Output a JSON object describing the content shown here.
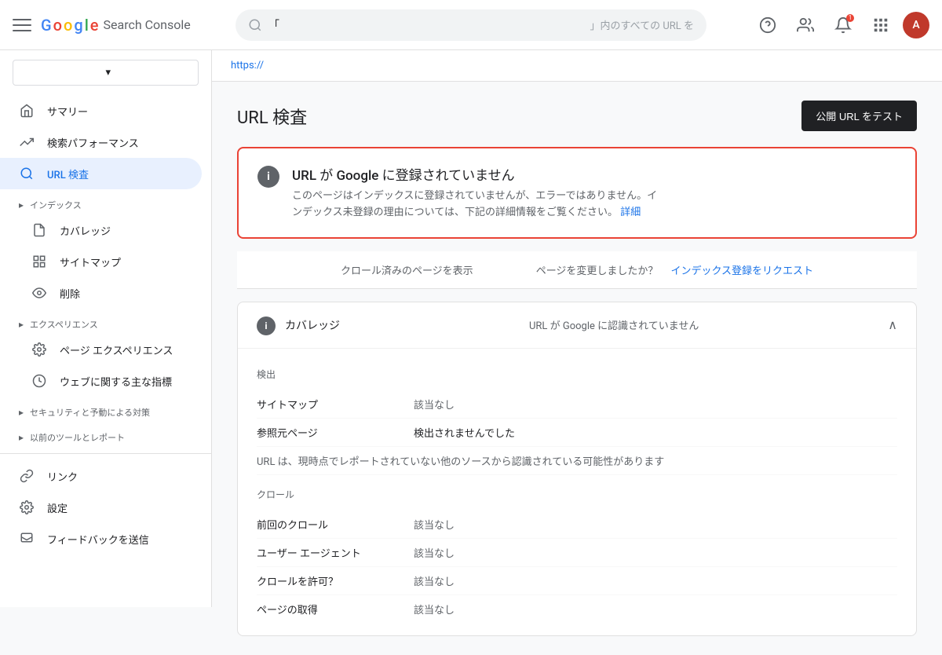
{
  "header": {
    "menu_icon": "≡",
    "logo": {
      "g": "G",
      "o1": "o",
      "o2": "o",
      "g2": "g",
      "l": "l",
      "e": "e"
    },
    "product_name": "Search Console",
    "search_placeholder": "」内のすべての URL を",
    "search_value": "「",
    "help_icon": "?",
    "accounts_icon": "👤",
    "notification_icon": "🔔",
    "notification_count": "1",
    "grid_icon": "⊞",
    "avatar_letter": "A"
  },
  "sidebar": {
    "property_placeholder": "",
    "nav_items": [
      {
        "id": "summary",
        "label": "サマリー",
        "icon": "🏠"
      },
      {
        "id": "search-performance",
        "label": "検索パフォーマンス",
        "icon": "↗"
      },
      {
        "id": "url-inspection",
        "label": "URL 検査",
        "icon": "🔍",
        "active": true
      }
    ],
    "section_index": {
      "label": "インデックス",
      "items": [
        {
          "id": "coverage",
          "label": "カバレッジ",
          "icon": "📄"
        },
        {
          "id": "sitemap",
          "label": "サイトマップ",
          "icon": "🗺"
        },
        {
          "id": "removal",
          "label": "削除",
          "icon": "👁"
        }
      ]
    },
    "section_experience": {
      "label": "エクスペリエンス",
      "items": [
        {
          "id": "page-experience",
          "label": "ページ エクスペリエンス",
          "icon": "⚙"
        },
        {
          "id": "web-vitals",
          "label": "ウェブに関する主な指標",
          "icon": "⏱"
        }
      ]
    },
    "section_security": {
      "label": "セキュリティと予動による対策"
    },
    "section_legacy": {
      "label": "以前のツールとレポート"
    },
    "bottom_items": [
      {
        "id": "links",
        "label": "リンク",
        "icon": "🔗"
      },
      {
        "id": "settings",
        "label": "設定",
        "icon": "⚙"
      },
      {
        "id": "feedback",
        "label": "フィードバックを送信",
        "icon": "💬"
      }
    ]
  },
  "main": {
    "url_bar": "https://",
    "page_title": "URL 検査",
    "test_button_label": "公開 URL をテスト",
    "status_card": {
      "icon": "i",
      "title": "URL が Google に登録されていません",
      "description": "このページはインデックスに登録されていませんが、エラーではありません。イ\nンデックス未登録の理由については、下記の詳細情報をご覧ください。",
      "link_text": "詳細"
    },
    "action_bar": {
      "crawled_link": "クロール済みのページを表示",
      "changed_label": "ページを変更しましたか？",
      "index_link": "インデックス登録をリクエスト"
    },
    "coverage_section": {
      "icon": "i",
      "title": "カバレッジ",
      "status": "URL が Google に認識されていません",
      "collapse_icon": "∧",
      "detection_section_label": "検出",
      "rows_detection": [
        {
          "label": "サイトマップ",
          "value": "該当なし",
          "type": "empty"
        },
        {
          "label": "参照元ページ",
          "value": "検出されませんでした",
          "type": "found"
        }
      ],
      "url_note": "URL は、現時点でレポートされていない他のソースから認識されている可能性があります",
      "crawl_section_label": "クロール",
      "rows_crawl": [
        {
          "label": "前回のクロール",
          "value": "該当なし",
          "type": "empty"
        },
        {
          "label": "ユーザー エージェント",
          "value": "該当なし",
          "type": "empty"
        },
        {
          "label": "クロールを許可？",
          "value": "該当なし",
          "type": "empty"
        },
        {
          "label": "ページの取得",
          "value": "該当なし",
          "type": "empty"
        }
      ]
    }
  }
}
